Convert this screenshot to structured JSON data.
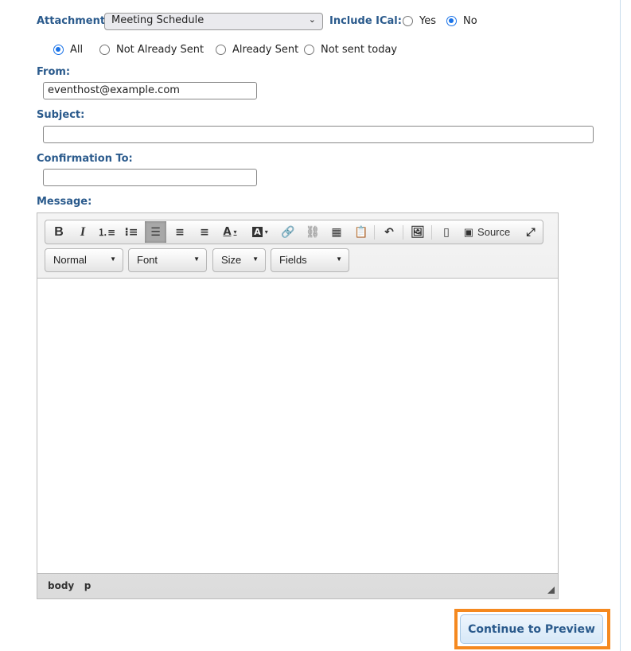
{
  "attachment": {
    "label": "Attachment:",
    "selected": "Meeting Schedule"
  },
  "ical": {
    "label": "Include ICal:",
    "options": [
      "Yes",
      "No"
    ],
    "selected": "No"
  },
  "filter": {
    "options": [
      "All",
      "Not Already Sent",
      "Already Sent",
      "Not sent today"
    ],
    "selected": "All"
  },
  "from": {
    "label": "From:",
    "value": "eventhost@example.com"
  },
  "subject": {
    "label": "Subject:",
    "value": ""
  },
  "confirmation": {
    "label": "Confirmation To:",
    "value": ""
  },
  "message": {
    "label": "Message:"
  },
  "toolbar": {
    "source_label": "Source",
    "combos": [
      "Normal",
      "Font",
      "Size",
      "Fields"
    ]
  },
  "footer": {
    "path": [
      "body",
      "p"
    ]
  },
  "continue_label": "Continue to Preview"
}
